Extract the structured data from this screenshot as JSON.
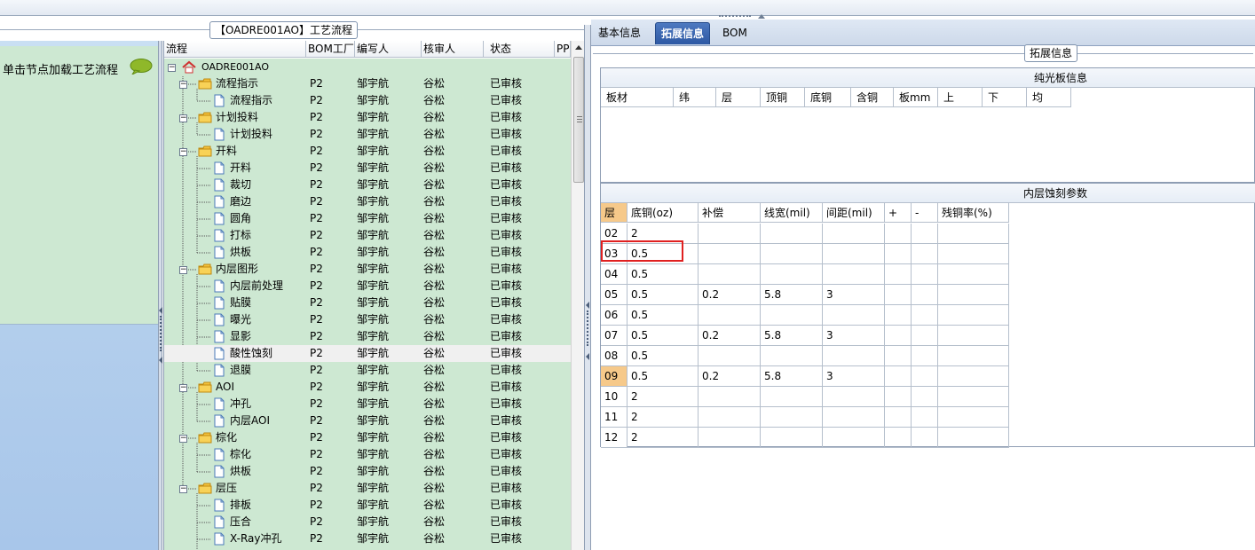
{
  "process_group_title": "【OADRE001AO】工艺流程",
  "left_panel": {
    "hint_label": "单击节点加载工艺流程"
  },
  "tree": {
    "columns": [
      "流程",
      "BOM工厂",
      "编写人",
      "核审人",
      "状态",
      "PPI"
    ],
    "rows": [
      {
        "name": "OADRE001AO",
        "level": 0,
        "type": "root",
        "factory": "",
        "author": "",
        "reviewer": "",
        "status": ""
      },
      {
        "name": "流程指示",
        "level": 1,
        "type": "folder",
        "factory": "P2",
        "author": "邹宇航",
        "reviewer": "谷松",
        "status": "已审核"
      },
      {
        "name": "流程指示",
        "level": 2,
        "type": "doc",
        "factory": "P2",
        "author": "邹宇航",
        "reviewer": "谷松",
        "status": "已审核"
      },
      {
        "name": "计划投料",
        "level": 1,
        "type": "folder",
        "factory": "P2",
        "author": "邹宇航",
        "reviewer": "谷松",
        "status": "已审核"
      },
      {
        "name": "计划投料",
        "level": 2,
        "type": "doc",
        "factory": "P2",
        "author": "邹宇航",
        "reviewer": "谷松",
        "status": "已审核"
      },
      {
        "name": "开料",
        "level": 1,
        "type": "folder",
        "factory": "P2",
        "author": "邹宇航",
        "reviewer": "谷松",
        "status": "已审核"
      },
      {
        "name": "开料",
        "level": 2,
        "type": "doc",
        "factory": "P2",
        "author": "邹宇航",
        "reviewer": "谷松",
        "status": "已审核"
      },
      {
        "name": "裁切",
        "level": 2,
        "type": "doc",
        "factory": "P2",
        "author": "邹宇航",
        "reviewer": "谷松",
        "status": "已审核"
      },
      {
        "name": "磨边",
        "level": 2,
        "type": "doc",
        "factory": "P2",
        "author": "邹宇航",
        "reviewer": "谷松",
        "status": "已审核"
      },
      {
        "name": "圆角",
        "level": 2,
        "type": "doc",
        "factory": "P2",
        "author": "邹宇航",
        "reviewer": "谷松",
        "status": "已审核"
      },
      {
        "name": "打标",
        "level": 2,
        "type": "doc",
        "factory": "P2",
        "author": "邹宇航",
        "reviewer": "谷松",
        "status": "已审核"
      },
      {
        "name": "烘板",
        "level": 2,
        "type": "doc",
        "factory": "P2",
        "author": "邹宇航",
        "reviewer": "谷松",
        "status": "已审核"
      },
      {
        "name": "内层图形",
        "level": 1,
        "type": "folder",
        "factory": "P2",
        "author": "邹宇航",
        "reviewer": "谷松",
        "status": "已审核"
      },
      {
        "name": "内层前处理",
        "level": 2,
        "type": "doc",
        "factory": "P2",
        "author": "邹宇航",
        "reviewer": "谷松",
        "status": "已审核"
      },
      {
        "name": "贴膜",
        "level": 2,
        "type": "doc",
        "factory": "P2",
        "author": "邹宇航",
        "reviewer": "谷松",
        "status": "已审核"
      },
      {
        "name": "曝光",
        "level": 2,
        "type": "doc",
        "factory": "P2",
        "author": "邹宇航",
        "reviewer": "谷松",
        "status": "已审核"
      },
      {
        "name": "显影",
        "level": 2,
        "type": "doc",
        "factory": "P2",
        "author": "邹宇航",
        "reviewer": "谷松",
        "status": "已审核"
      },
      {
        "name": "酸性蚀刻",
        "level": 2,
        "type": "doc",
        "factory": "P2",
        "author": "邹宇航",
        "reviewer": "谷松",
        "status": "已审核",
        "selected": true
      },
      {
        "name": "退膜",
        "level": 2,
        "type": "doc",
        "factory": "P2",
        "author": "邹宇航",
        "reviewer": "谷松",
        "status": "已审核"
      },
      {
        "name": "AOI",
        "level": 1,
        "type": "folder",
        "factory": "P2",
        "author": "邹宇航",
        "reviewer": "谷松",
        "status": "已审核"
      },
      {
        "name": "冲孔",
        "level": 2,
        "type": "doc",
        "factory": "P2",
        "author": "邹宇航",
        "reviewer": "谷松",
        "status": "已审核"
      },
      {
        "name": "内层AOI",
        "level": 2,
        "type": "doc",
        "factory": "P2",
        "author": "邹宇航",
        "reviewer": "谷松",
        "status": "已审核"
      },
      {
        "name": "棕化",
        "level": 1,
        "type": "folder",
        "factory": "P2",
        "author": "邹宇航",
        "reviewer": "谷松",
        "status": "已审核"
      },
      {
        "name": "棕化",
        "level": 2,
        "type": "doc",
        "factory": "P2",
        "author": "邹宇航",
        "reviewer": "谷松",
        "status": "已审核"
      },
      {
        "name": "烘板",
        "level": 2,
        "type": "doc",
        "factory": "P2",
        "author": "邹宇航",
        "reviewer": "谷松",
        "status": "已审核"
      },
      {
        "name": "层压",
        "level": 1,
        "type": "folder",
        "factory": "P2",
        "author": "邹宇航",
        "reviewer": "谷松",
        "status": "已审核"
      },
      {
        "name": "排板",
        "level": 2,
        "type": "doc",
        "factory": "P2",
        "author": "邹宇航",
        "reviewer": "谷松",
        "status": "已审核"
      },
      {
        "name": "压合",
        "level": 2,
        "type": "doc",
        "factory": "P2",
        "author": "邹宇航",
        "reviewer": "谷松",
        "status": "已审核"
      },
      {
        "name": "X-Ray冲孔",
        "level": 2,
        "type": "doc",
        "factory": "P2",
        "author": "邹宇航",
        "reviewer": "谷松",
        "status": "已审核"
      }
    ]
  },
  "tabs": [
    {
      "label": "基本信息",
      "active": false
    },
    {
      "label": "拓展信息",
      "active": true
    },
    {
      "label": "BOM",
      "active": false
    }
  ],
  "ext_group_title": "拓展信息",
  "plain_board": {
    "title": "纯光板信息",
    "columns": [
      "板材",
      "纬",
      "层",
      "顶铜",
      "底铜",
      "含铜",
      "板mm",
      "上",
      "下",
      "均"
    ]
  },
  "inner_etch": {
    "title": "内层蚀刻参数",
    "columns": [
      "层",
      "底铜(oz)",
      "补偿",
      "线宽(mil)",
      "间距(mil)",
      "+",
      "-",
      "残铜率(%)"
    ],
    "rows": [
      {
        "layer": "02",
        "cu": "2",
        "comp": "",
        "width": "",
        "space": ""
      },
      {
        "layer": "03",
        "cu": "0.5",
        "comp": "",
        "width": "",
        "space": ""
      },
      {
        "layer": "04",
        "cu": "0.5",
        "comp": "",
        "width": "",
        "space": ""
      },
      {
        "layer": "05",
        "cu": "0.5",
        "comp": "0.2",
        "width": "5.8",
        "space": "3"
      },
      {
        "layer": "06",
        "cu": "0.5",
        "comp": "",
        "width": "",
        "space": ""
      },
      {
        "layer": "07",
        "cu": "0.5",
        "comp": "0.2",
        "width": "5.8",
        "space": "3"
      },
      {
        "layer": "08",
        "cu": "0.5",
        "comp": "",
        "width": "",
        "space": ""
      },
      {
        "layer": "09",
        "cu": "0.5",
        "comp": "0.2",
        "width": "5.8",
        "space": "3",
        "highlight": true
      },
      {
        "layer": "10",
        "cu": "2",
        "comp": "",
        "width": "",
        "space": ""
      },
      {
        "layer": "11",
        "cu": "2",
        "comp": "",
        "width": "",
        "space": ""
      },
      {
        "layer": "12",
        "cu": "2",
        "comp": "",
        "width": "",
        "space": ""
      }
    ]
  },
  "colors": {
    "tree_bg": "#cde8d2",
    "tab_active": "#2d58a3",
    "layer_highlight": "#f6c98a",
    "annotation_red": "#e02020"
  },
  "icons": [
    "home-icon",
    "folder-icon",
    "document-icon",
    "speech-bubble-icon",
    "scroll-up-icon"
  ]
}
